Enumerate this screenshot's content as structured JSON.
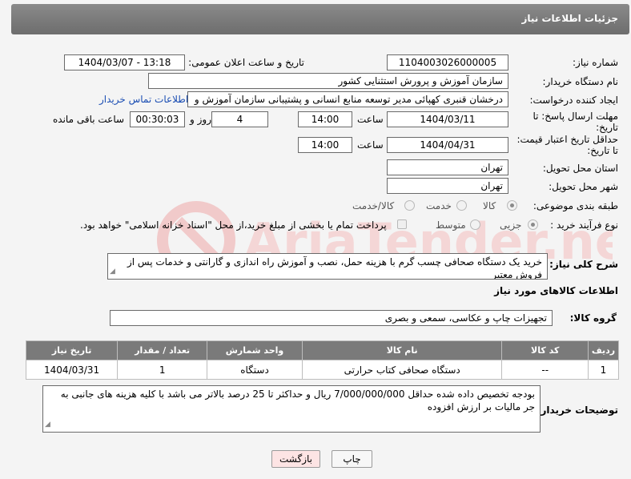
{
  "header": {
    "title": "جزئیات اطلاعات نیاز"
  },
  "fields": {
    "need_number_label": "شماره نیاز:",
    "need_number": "1104003026000005",
    "announce_label": "تاریخ و ساعت اعلان عمومی:",
    "announce_value": "1404/03/07 - 13:18",
    "buyer_org_label": "نام دستگاه خریدار:",
    "buyer_org": "سازمان آموزش و پرورش استثنایی کشور",
    "requester_label": "ایجاد کننده درخواست:",
    "requester": "درخشان قنبری کهپائی مدیر توسعه منابع انسانی و پشتیبانی سازمان آموزش و",
    "buyer_contact_link": "اطلاعات تماس خریدار",
    "deadline_label": "مهلت ارسال پاسخ: تا تاریخ:",
    "deadline_date": "1404/03/11",
    "time_label": "ساعت",
    "deadline_time": "14:00",
    "days_value": "4",
    "days_label": "روز و",
    "remaining_value": "00:30:03",
    "remaining_label": "ساعت باقی مانده",
    "price_validity_label": "حداقل تاریخ اعتبار قیمت: تا تاریخ:",
    "price_date": "1404/04/31",
    "price_time": "14:00",
    "province_label": "استان محل تحویل:",
    "province": "تهران",
    "city_label": "شهر محل تحویل:",
    "city": "تهران",
    "category_label": "طبقه بندی موضوعی:",
    "category_options": [
      "کالا",
      "خدمت",
      "کالا/خدمت"
    ],
    "process_label": "نوع فرآیند خرید :",
    "process_options": [
      "جزیی",
      "متوسط"
    ],
    "payment_note": "پرداخت تمام یا بخشی از مبلغ خرید،از محل \"اسناد خزانه اسلامی\" خواهد بود."
  },
  "description": {
    "label": "شرح کلی نیاز:",
    "text": "خرید یک دستگاه صحافی چسب گرم با هزینه حمل، نصب و آموزش راه اندازی و گارانتی و خدمات پس از فروش معتبر"
  },
  "goods_info": {
    "title": "اطلاعات کالاهای مورد نیاز",
    "group_label": "گروه کالا:",
    "group_value": "تجهیزات چاپ و عکاسی، سمعی و بصری"
  },
  "table": {
    "headers": [
      "ردیف",
      "کد کالا",
      "نام کالا",
      "واحد شمارش",
      "تعداد / مقدار",
      "تاریخ نیاز"
    ],
    "rows": [
      [
        "1",
        "--",
        "دستگاه صحافی کتاب حرارتی",
        "دستگاه",
        "1",
        "1404/03/31"
      ]
    ]
  },
  "buyer_notes": {
    "label": "توضیحات خریدار:",
    "text": "بودجه تخصیص داده شده حداقل 7/000/000/000 ریال و حداکثر تا 25 درصد بالاتر می باشد  با کلیه هزینه های جانبی به جر مالیات بر ارزش افزوده"
  },
  "buttons": {
    "print": "چاپ",
    "back": "بازگشت"
  },
  "watermark": {
    "text": "AriaTender.neT"
  },
  "colors": {
    "header_bg": "#7a7a7a",
    "link": "#1a4db3",
    "back_button_bg": "#fde4e4",
    "watermark": "#f1caca"
  }
}
